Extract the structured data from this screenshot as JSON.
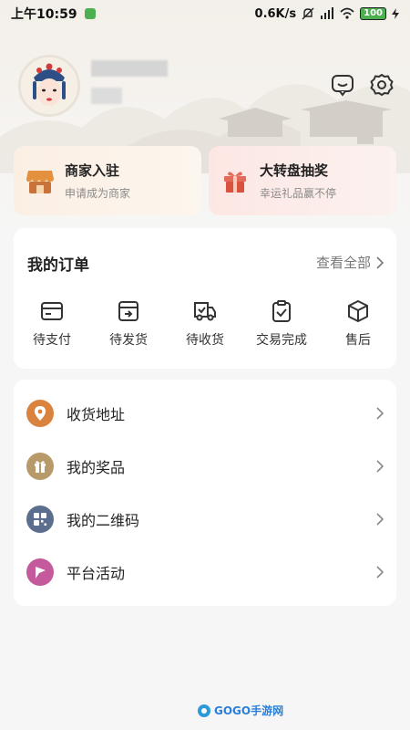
{
  "status_bar": {
    "time": "上午10:59",
    "network_speed": "0.6K/s",
    "battery": "100"
  },
  "header": {
    "avatar_alt": "opera-mask-avatar",
    "message_icon": "message-icon",
    "settings_icon": "settings-icon"
  },
  "promos": [
    {
      "title": "商家入驻",
      "subtitle": "申请成为商家",
      "icon": "shop-icon"
    },
    {
      "title": "大转盘抽奖",
      "subtitle": "幸运礼品赢不停",
      "icon": "gift-icon"
    }
  ],
  "orders": {
    "title": "我的订单",
    "view_all": "查看全部",
    "items": [
      {
        "label": "待支付",
        "icon": "wallet-icon"
      },
      {
        "label": "待发货",
        "icon": "box-send-icon"
      },
      {
        "label": "待收货",
        "icon": "truck-icon"
      },
      {
        "label": "交易完成",
        "icon": "clipboard-check-icon"
      },
      {
        "label": "售后",
        "icon": "package-icon"
      }
    ]
  },
  "menu": [
    {
      "label": "收货地址",
      "icon": "location-icon",
      "color": "#d9833f"
    },
    {
      "label": "我的奖品",
      "icon": "prize-icon",
      "color": "#b89a6a"
    },
    {
      "label": "我的二维码",
      "icon": "qrcode-icon",
      "color": "#5c6e8e"
    },
    {
      "label": "平台活动",
      "icon": "flag-icon",
      "color": "#c45a9c"
    }
  ],
  "watermark": "GOGO手游网"
}
